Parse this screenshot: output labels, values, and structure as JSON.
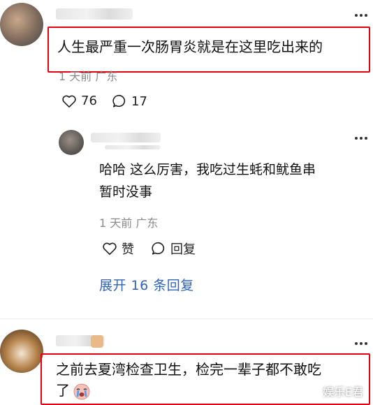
{
  "comments": [
    {
      "text": "人生最严重一次肠胃炎就是在这里吃出来的",
      "meta": "1 天前 广东",
      "likes": "76",
      "replies": "17"
    },
    {
      "text_line1": "哈哈 这么厉害，我吃过生蚝和鱿鱼串",
      "text_line2": "暂时没事",
      "meta": "1 天前 广东",
      "like_label": "赞",
      "reply_label": "回复"
    },
    {
      "text_line1": "之前去夏湾检查卫生，检完一辈子都不敢吃",
      "text_line2": "了"
    }
  ],
  "expand_replies_label": "展开 16 条回复",
  "watermark": "娱乐E君",
  "colors": {
    "highlight": "#e60012",
    "link": "#2e63b8",
    "meta": "#8a8a8a"
  },
  "icons": [
    "more-icon",
    "heart-icon",
    "comment-bubble-icon",
    "crying-emoji-icon"
  ]
}
